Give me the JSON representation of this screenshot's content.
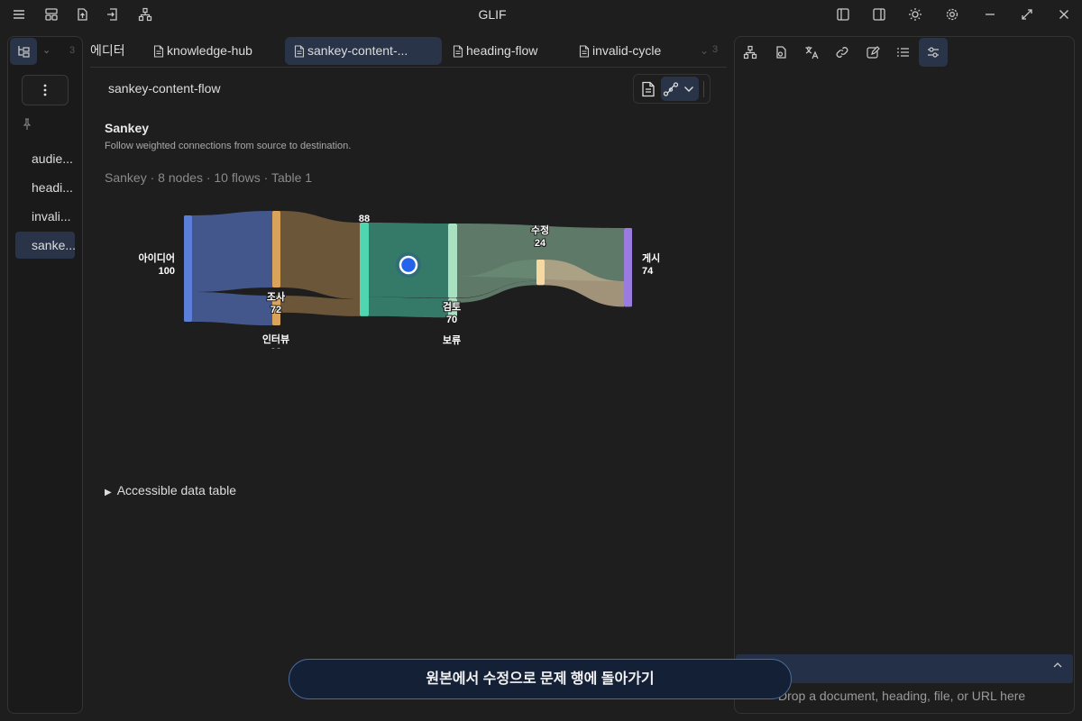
{
  "app": {
    "title": "GLIF"
  },
  "tabs": [
    {
      "label": "에디터",
      "active": false
    },
    {
      "label": "knowledge-hub",
      "active": false
    },
    {
      "label": "sankey-content-...",
      "active": true
    },
    {
      "label": "heading-flow",
      "active": false
    },
    {
      "label": "invalid-cycle",
      "active": false
    }
  ],
  "tab_overflow_count": "3",
  "tab_left_count": "3",
  "sidebar": {
    "files": [
      {
        "label": "audie...",
        "active": false
      },
      {
        "label": "headi...",
        "active": false
      },
      {
        "label": "invali...",
        "active": false
      },
      {
        "label": "sanke...",
        "active": true
      }
    ]
  },
  "note": {
    "title": "sankey-content-flow",
    "chart_heading": "Sankey",
    "chart_description": "Follow weighted connections from source to destination.",
    "chart_meta": "Sankey · 8 nodes · 10 flows · Table 1",
    "accessible_table_label": "Accessible data table"
  },
  "bottom_button": {
    "label": "원본에서 수정으로 문제 행에 돌아가기"
  },
  "drop_zone": {
    "placeholder": "Drop a document, heading, file, or URL here",
    "count": "0"
  },
  "colors": {
    "accent": "#2a3448",
    "node_source": "#5b7fd9",
    "node_research": "#d9a35a",
    "node_draft": "#4fd6b0",
    "node_review": "#a8e0c0",
    "node_edit": "#f5d9a0",
    "node_publish": "#9a7be0"
  },
  "chart_data": {
    "type": "sankey",
    "nodes": [
      {
        "id": "idea",
        "name": "아이디어",
        "value": 100
      },
      {
        "id": "research",
        "name": "조사",
        "value": 72
      },
      {
        "id": "interview",
        "name": "인터뷰",
        "value": 28
      },
      {
        "id": "draft",
        "name": "",
        "value": 88
      },
      {
        "id": "review",
        "name": "검토",
        "value": 70
      },
      {
        "id": "hold",
        "name": "보류",
        "value": 18
      },
      {
        "id": "edit",
        "name": "수정",
        "value": 24
      },
      {
        "id": "publish",
        "name": "게시",
        "value": 74
      }
    ],
    "links": [
      {
        "source": "idea",
        "target": "research",
        "value": 72
      },
      {
        "source": "idea",
        "target": "interview",
        "value": 28
      },
      {
        "source": "research",
        "target": "draft",
        "value": 72
      },
      {
        "source": "interview",
        "target": "draft",
        "value": 16
      },
      {
        "source": "draft",
        "target": "review",
        "value": 70
      },
      {
        "source": "draft",
        "target": "hold",
        "value": 18
      },
      {
        "source": "review",
        "target": "publish",
        "value": 50
      },
      {
        "source": "review",
        "target": "edit",
        "value": 20
      },
      {
        "source": "hold",
        "target": "edit",
        "value": 4
      },
      {
        "source": "edit",
        "target": "publish",
        "value": 24
      }
    ]
  }
}
